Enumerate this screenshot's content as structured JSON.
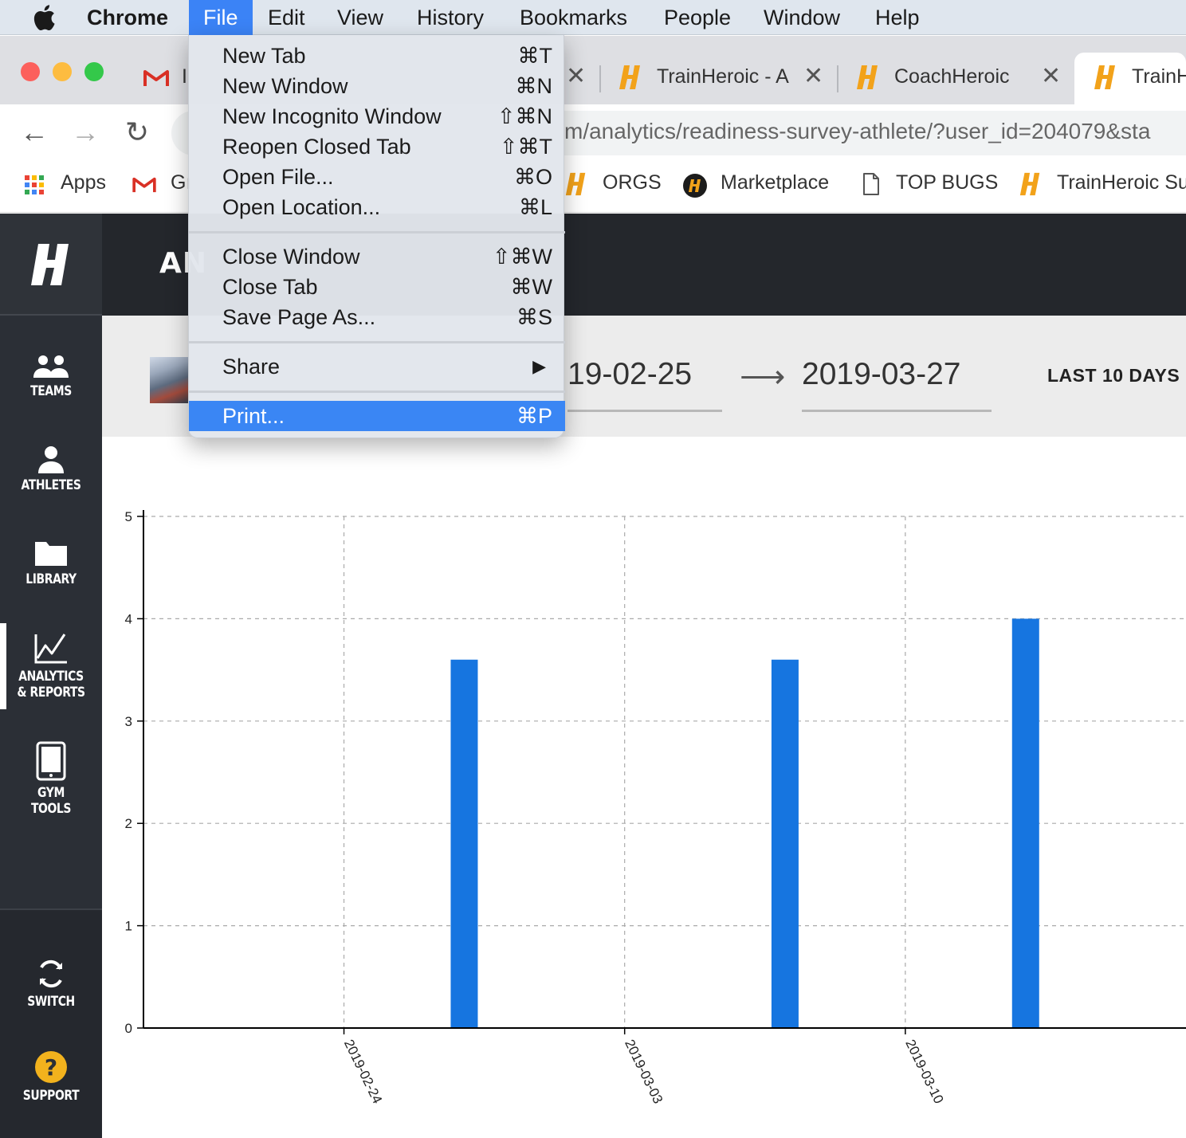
{
  "menubar": {
    "app": "Chrome",
    "items": [
      "File",
      "Edit",
      "View",
      "History",
      "Bookmarks",
      "People",
      "Window",
      "Help"
    ]
  },
  "tabs": [
    {
      "label": "I",
      "icon": "gmail-icon"
    },
    {
      "label": "TrainHeroic - A",
      "icon": "trainheroic-icon"
    },
    {
      "label": "CoachHeroic",
      "icon": "trainheroic-icon"
    },
    {
      "label": "TrainH",
      "icon": "trainheroic-icon",
      "active": true
    }
  ],
  "toolbar": {
    "url": "m/analytics/readiness-survey-athlete/?user_id=204079&sta"
  },
  "bookmarks": [
    {
      "label": "Apps",
      "icon": "apps-grid-icon"
    },
    {
      "label": "Gı",
      "icon": "gmail-icon"
    },
    {
      "label": "ORGS",
      "icon": "trainheroic-icon"
    },
    {
      "label": "Marketplace",
      "icon": "trainheroic-round-icon"
    },
    {
      "label": "TOP BUGS",
      "icon": "page-icon"
    },
    {
      "label": "TrainHeroic Su",
      "icon": "trainheroic-icon"
    }
  ],
  "sidebar": {
    "items": [
      {
        "label": "TEAMS",
        "icon": "people-icon"
      },
      {
        "label": "ATHLETES",
        "icon": "person-icon"
      },
      {
        "label": "LIBRARY",
        "icon": "folder-icon"
      },
      {
        "label": "ANALYTICS\n& REPORTS",
        "icon": "chart-line-icon",
        "active": true
      },
      {
        "label": "GYM\nTOOLS",
        "icon": "tablet-icon"
      },
      {
        "label": "SWITCH",
        "icon": "refresh-icon"
      },
      {
        "label": "SUPPORT",
        "icon": "help-icon"
      }
    ]
  },
  "header": {
    "title": "AN"
  },
  "filters": {
    "start_date": "19-02-25",
    "end_date": "2019-03-27",
    "range_label": "LAST 10 DAYS"
  },
  "file_menu": {
    "groups": [
      [
        {
          "label": "New Tab",
          "shortcut": "⌘T"
        },
        {
          "label": "New Window",
          "shortcut": "⌘N"
        },
        {
          "label": "New Incognito Window",
          "shortcut": "⇧⌘N"
        },
        {
          "label": "Reopen Closed Tab",
          "shortcut": "⇧⌘T"
        },
        {
          "label": "Open File...",
          "shortcut": "⌘O"
        },
        {
          "label": "Open Location...",
          "shortcut": "⌘L"
        }
      ],
      [
        {
          "label": "Close Window",
          "shortcut": "⇧⌘W"
        },
        {
          "label": "Close Tab",
          "shortcut": "⌘W"
        },
        {
          "label": "Save Page As...",
          "shortcut": "⌘S"
        }
      ],
      [
        {
          "label": "Share",
          "shortcut": "▶"
        }
      ],
      [
        {
          "label": "Print...",
          "shortcut": "⌘P",
          "highlighted": true
        }
      ]
    ]
  },
  "chart_data": {
    "type": "bar",
    "x_type": "date",
    "x": [
      "2019-02-27",
      "2019-03-07",
      "2019-03-13"
    ],
    "values": [
      3.6,
      3.6,
      4
    ],
    "xlim": [
      "2019-02-19",
      "2019-03-17"
    ],
    "x_ticks": [
      "2019-02-24",
      "2019-03-03",
      "2019-03-10"
    ],
    "ylim": [
      0,
      5
    ],
    "y_ticks": [
      0,
      1,
      2,
      3,
      4,
      5
    ],
    "grid": true,
    "color": "#1675e0"
  }
}
